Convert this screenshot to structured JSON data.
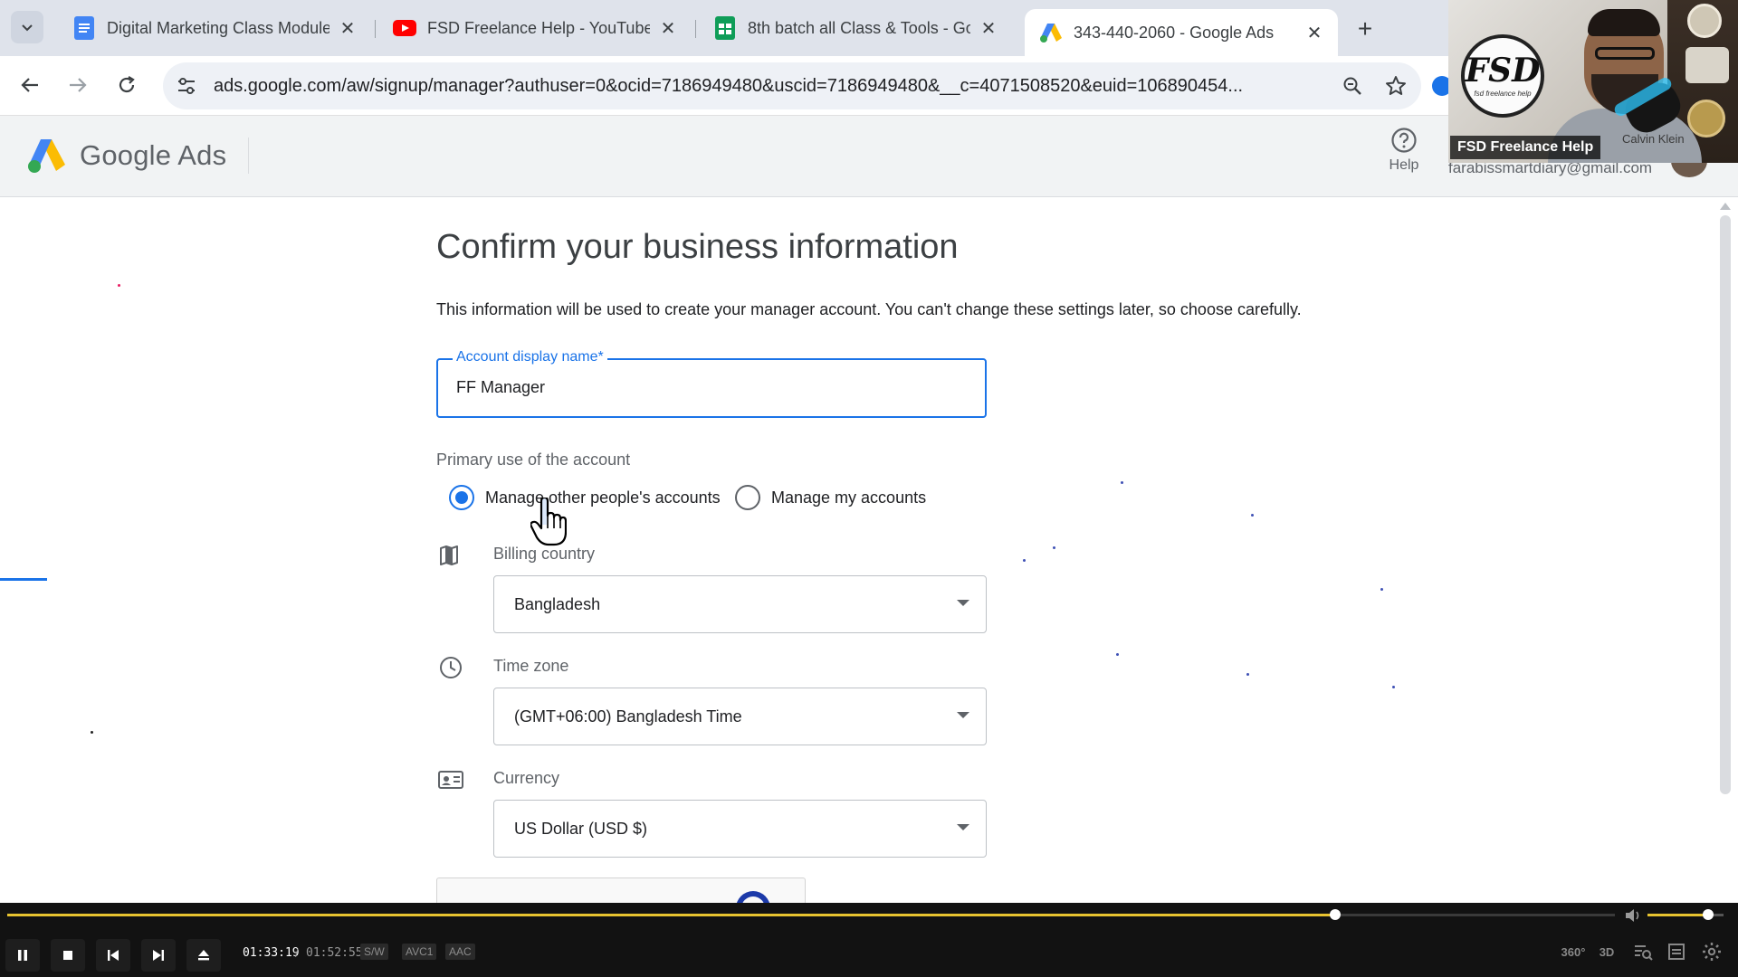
{
  "browser": {
    "tabs": [
      {
        "title": "Digital Marketing Class Module",
        "favicon": "docs-icon"
      },
      {
        "title": "FSD Freelance Help - YouTube",
        "favicon": "youtube-icon"
      },
      {
        "title": "8th batch all Class & Tools - Go",
        "favicon": "sheets-icon"
      },
      {
        "title": "343-440-2060 - Google Ads",
        "favicon": "google-ads-icon",
        "active": true
      }
    ],
    "close_glyph": "✕",
    "newtab_glyph": "+",
    "url": "ads.google.com/aw/signup/manager?authuser=0&ocid=7186949480&uscid=7186949480&__c=4071508520&euid=106890454..."
  },
  "ads_header": {
    "brand_google": "Google",
    "brand_ads": "Ads",
    "help_label": "Help",
    "account_email": "farabissmartdiary@gmail.com"
  },
  "webcam": {
    "channel_label": "FSD Freelance Help",
    "logo_text": "FSD",
    "logo_sub": "fsd freelance help",
    "brand_tag": "Calvin Klein"
  },
  "form": {
    "title": "Confirm your business information",
    "description": "This information will be used to create your manager account. You can't change these settings later, so choose carefully.",
    "name_label": "Account display name*",
    "name_value": "FF Manager",
    "primary_use_label": "Primary use of the account",
    "primary_use_options": [
      {
        "label": "Manage other people's accounts",
        "checked": true
      },
      {
        "label": "Manage my accounts",
        "checked": false
      }
    ],
    "billing_country_label": "Billing country",
    "billing_country_value": "Bangladesh",
    "time_zone_label": "Time zone",
    "time_zone_value": "(GMT+06:00) Bangladesh Time",
    "currency_label": "Currency",
    "currency_value": "US Dollar (USD $)"
  },
  "player": {
    "current_time": "01:33:19",
    "separator": "/",
    "total_time": "01:52:55",
    "progress": 0.826,
    "volume": 0.8,
    "badges": [
      "S/W",
      "AVC1",
      "AAC"
    ],
    "right_controls": [
      "360°",
      "3D"
    ]
  },
  "colors": {
    "accent": "#1a73e8",
    "seek": "#e8c330",
    "tab_strip": "#dfe3eb",
    "header_bg": "#f1f3f4"
  }
}
